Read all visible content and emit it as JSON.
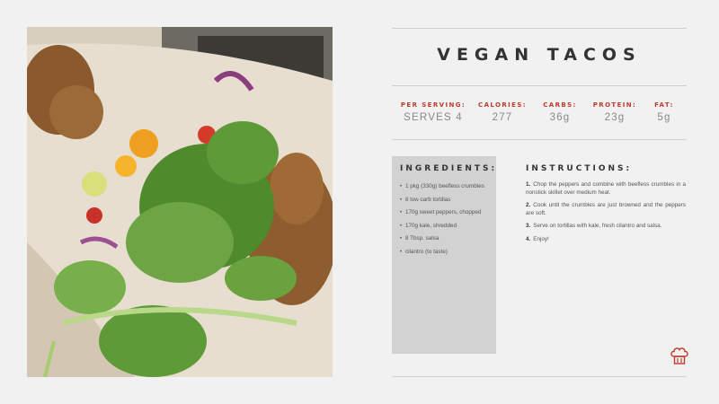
{
  "recipe": {
    "title": "VEGAN TACOS",
    "stats": [
      {
        "label": "PER SERVING:",
        "value": "SERVES 4"
      },
      {
        "label": "CALORIES:",
        "value": "277"
      },
      {
        "label": "CARBS:",
        "value": "36g"
      },
      {
        "label": "PROTEIN:",
        "value": "23g"
      },
      {
        "label": "FAT:",
        "value": "5g"
      }
    ],
    "ingredients": {
      "heading": "INGREDIENTS:",
      "items": [
        "1 pkg (330g) beefless crumbles",
        "8 low carb tortillas",
        "170g sweet peppers, chopped",
        "170g kale, shredded",
        "8 Tbsp. salsa",
        "cilantro (to taste)"
      ]
    },
    "instructions": {
      "heading": "INSTRUCTIONS:",
      "steps": [
        {
          "num": "1.",
          "text": "Chop the peppers and combine with beefless crumbles in a nonstick skillet over medium heat."
        },
        {
          "num": "2.",
          "text": "Cook until the crumbles are just browned and the peppers are soft."
        },
        {
          "num": "3.",
          "text": "Serve on tortillas with kale, fresh cilantro and salsa."
        },
        {
          "num": "4.",
          "text": "Enjoy!"
        }
      ]
    }
  },
  "icons": {
    "photo": "taco-photo",
    "chef": "chef-hat-icon"
  },
  "colors": {
    "accent": "#c0392b",
    "background": "#f1f1f1",
    "panel": "#d2d2d2"
  }
}
